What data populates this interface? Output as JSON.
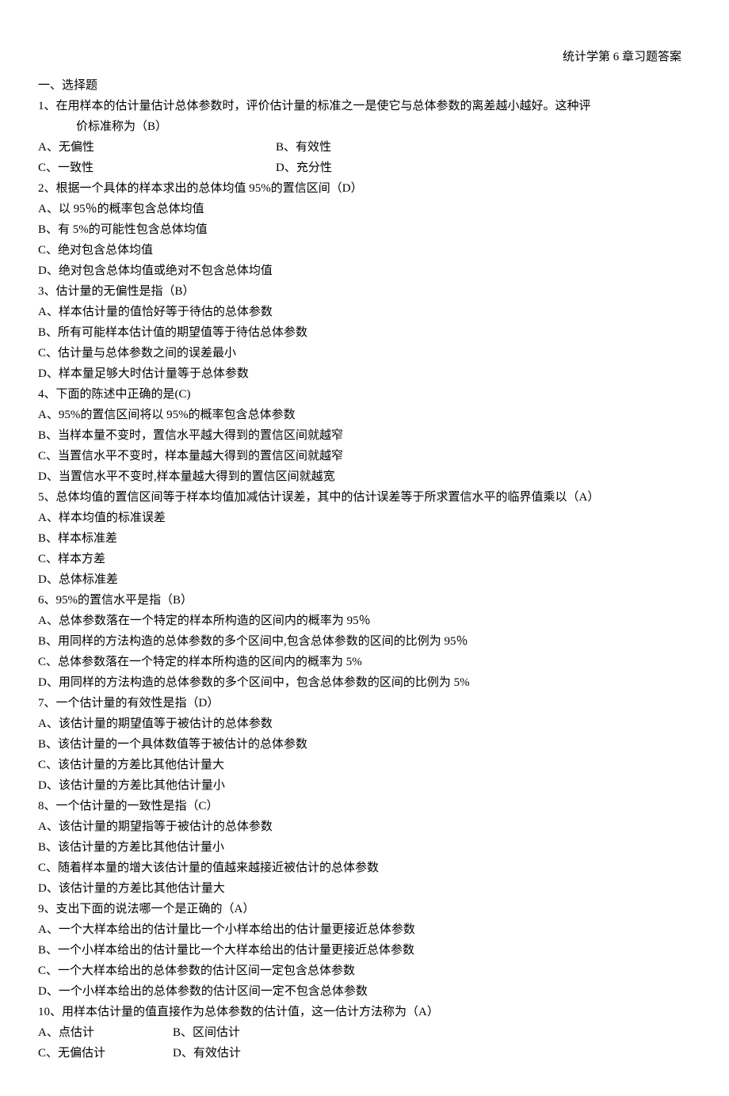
{
  "header": "统计学第 6 章习题答案",
  "sectionTitle": "一、选择题",
  "questions": [
    {
      "num": "1、",
      "text": "在用样本的估计量估计总体参数时，评价估计量的标准之一是使它与总体参数的离差越小越好。这种评",
      "cont": "价标准称为（B）",
      "opts": [
        {
          "left": "A、无偏性",
          "right": "B、有效性"
        },
        {
          "left": "C、一致性",
          "right": "D、充分性"
        }
      ]
    },
    {
      "num": "2、",
      "text": "根据一个具体的样本求出的总体均值 95%的置信区间（D）",
      "list": [
        "A、以 95％的概率包含总体均值",
        "B、有 5%的可能性包含总体均值",
        "C、绝对包含总体均值",
        "D、绝对包含总体均值或绝对不包含总体均值"
      ]
    },
    {
      "num": "3、",
      "text": "估计量的无偏性是指（B）",
      "list": [
        "A、样本估计量的值恰好等于待估的总体参数",
        "B、所有可能样本估计值的期望值等于待估总体参数",
        "C、估计量与总体参数之间的误差最小",
        "D、样本量足够大时估计量等于总体参数"
      ]
    },
    {
      "num": "4、",
      "text": "下面的陈述中正确的是(C)",
      "list": [
        "A、95%的置信区间将以 95%的概率包含总体参数",
        "B、当样本量不变时，置信水平越大得到的置信区间就越窄",
        "C、当置信水平不变时，样本量越大得到的置信区间就越窄",
        "D、当置信水平不变时,样本量越大得到的置信区间就越宽"
      ]
    },
    {
      "num": "5、",
      "text": "总体均值的置信区间等于样本均值加减估计误差，其中的估计误差等于所求置信水平的临界值乘以（A）",
      "list": [
        "A、样本均值的标准误差",
        "B、样本标准差",
        "C、样本方差",
        "D、总体标准差"
      ]
    },
    {
      "num": "6、",
      "text": "95%的置信水平是指（B）",
      "list": [
        "A、总体参数落在一个特定的样本所构造的区间内的概率为 95％",
        "B、用同样的方法构造的总体参数的多个区间中,包含总体参数的区间的比例为 95％",
        "C、总体参数落在一个特定的样本所构造的区间内的概率为 5%",
        "D、用同样的方法构造的总体参数的多个区间中，包含总体参数的区间的比例为 5%"
      ]
    },
    {
      "num": "7、",
      "text": "一个估计量的有效性是指（D）",
      "list": [
        "A、该估计量的期望值等于被估计的总体参数",
        "B、该估计量的一个具体数值等于被估计的总体参数",
        "C、该估计量的方差比其他估计量大",
        "D、该估计量的方差比其他估计量小"
      ]
    },
    {
      "num": "8、",
      "text": "一个估计量的一致性是指（C）",
      "list": [
        "A、该估计量的期望指等于被估计的总体参数",
        "B、该估计量的方差比其他估计量小",
        "C、随着样本量的增大该估计量的值越来越接近被估计的总体参数",
        "D、该估计量的方差比其他估计量大"
      ]
    },
    {
      "num": "9、",
      "text": "支出下面的说法哪一个是正确的（A）",
      "list": [
        "A、一个大样本给出的估计量比一个小样本给出的估计量更接近总体参数",
        "B、一个小样本给出的估计量比一个大样本给出的估计量更接近总体参数",
        "C、一个大样本给出的总体参数的估计区间一定包含总体参数",
        "D、一个小样本给出的总体参数的估计区间一定不包含总体参数"
      ]
    },
    {
      "num": "10、",
      "text": "用样本估计量的值直接作为总体参数的估计值，这一估计方法称为（A）",
      "opts2": [
        {
          "left": "A、点估计",
          "right": "B、区间估计"
        },
        {
          "left": "C、无偏估计",
          "right": "D、有效估计"
        }
      ]
    }
  ]
}
